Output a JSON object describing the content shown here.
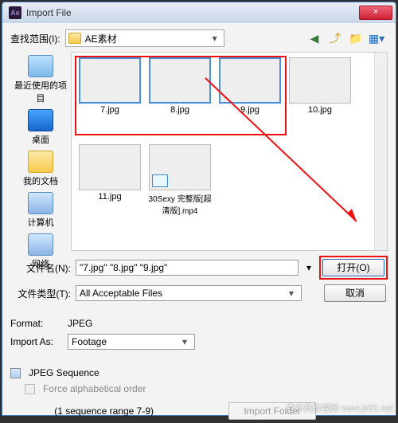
{
  "titlebar": {
    "app_icon_text": "Ae",
    "title": "Import File",
    "close": "×"
  },
  "nav": {
    "look_in_label": "查找范围(I):",
    "folder_name": "AE素材"
  },
  "places": {
    "recent": "最近使用的项目",
    "desktop": "桌面",
    "documents": "我的文档",
    "computer": "计算机",
    "network": "网络"
  },
  "files": {
    "selected": [
      "7.jpg",
      "8.jpg",
      "9.jpg"
    ],
    "others": [
      "10.jpg"
    ],
    "row2": [
      {
        "name": "11.jpg",
        "type": "image"
      },
      {
        "name": "30Sexy 完整版[超清版].mp4",
        "type": "video"
      }
    ]
  },
  "form": {
    "filename_label": "文件名(N):",
    "filename_value": "\"7.jpg\" \"8.jpg\" \"9.jpg\"",
    "filetype_label": "文件类型(T):",
    "filetype_value": "All Acceptable Files",
    "open_btn": "打开(O)",
    "cancel_btn": "取消"
  },
  "section": {
    "format_label": "Format:",
    "format_value": "JPEG",
    "import_as_label": "Import As:",
    "import_as_value": "Footage",
    "jpeg_sequence": "JPEG Sequence",
    "force_alpha": "Force alphabetical order",
    "sequence_range": "(1 sequence range 7-9)",
    "import_folder": "Import Folder"
  },
  "watermark": "查字典教程网 www.jb51.net"
}
